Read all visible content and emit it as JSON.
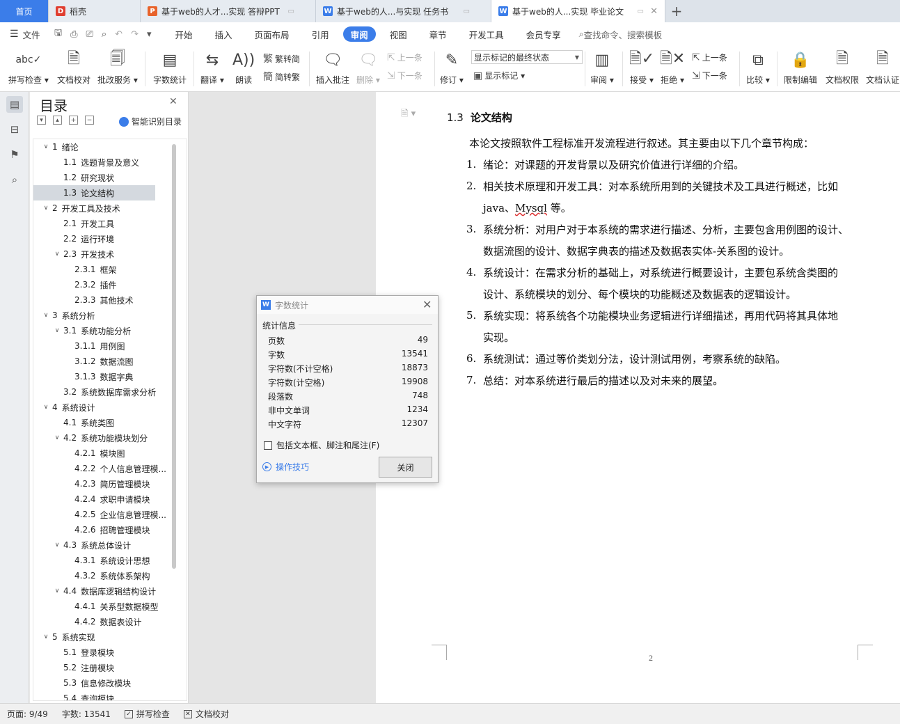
{
  "tabs": [
    {
      "label": "首页",
      "icon": "home",
      "active": false
    },
    {
      "label": "稻壳",
      "icon": "daoke-icon",
      "active": false
    },
    {
      "label": "基于web的人才...实现 答辩PPT",
      "icon": "ppt-icon",
      "active": false
    },
    {
      "label": "基于web的人...与实现 任务书",
      "icon": "wps-writer-icon",
      "active": false
    },
    {
      "label": "基于web的人...实现 毕业论文",
      "icon": "wps-writer-icon",
      "active": true
    }
  ],
  "menubar": {
    "file_label": "文件",
    "items": [
      "开始",
      "插入",
      "页面布局",
      "引用",
      "审阅",
      "视图",
      "章节",
      "开发工具",
      "会员专享"
    ],
    "active": "审阅",
    "search_label": "查找命令、搜索模板"
  },
  "ribbon": {
    "spell_check": "拼写检查",
    "doc_proof": "文档校对",
    "revise_service": "批改服务",
    "word_count": "字数统计",
    "translate": "翻译",
    "read_aloud": "朗读",
    "trad_conv": "繁转简",
    "simp_conv": "简转繁",
    "insert_comment": "插入批注",
    "delete": "删除",
    "prev_comment": "上一条",
    "next_comment": "下一条",
    "revise": "修订",
    "markup_state": "显示标记的最终状态",
    "show_markup": "显示标记",
    "review": "审阅",
    "accept": "接受",
    "reject": "拒绝",
    "prev_change": "上一条",
    "next_change": "下一条",
    "compare": "比较",
    "restrict_edit": "限制编辑",
    "doc_permission": "文档权限",
    "doc_auth": "文档认证"
  },
  "toc": {
    "title": "目录",
    "smart_label": "智能识别目录",
    "items": [
      {
        "num": "1",
        "text": "绪论",
        "level": 1,
        "toggle": "expanded"
      },
      {
        "num": "1.1",
        "text": "选题背景及意义",
        "level": 2,
        "toggle": "none"
      },
      {
        "num": "1.2",
        "text": "研究现状",
        "level": 2,
        "toggle": "none"
      },
      {
        "num": "1.3",
        "text": "论文结构",
        "level": 2,
        "toggle": "none",
        "selected": true
      },
      {
        "num": "2",
        "text": "开发工具及技术",
        "level": 1,
        "toggle": "expanded"
      },
      {
        "num": "2.1",
        "text": "开发工具",
        "level": 2,
        "toggle": "none"
      },
      {
        "num": "2.2",
        "text": "运行环境",
        "level": 2,
        "toggle": "none"
      },
      {
        "num": "2.3",
        "text": "开发技术",
        "level": 2,
        "toggle": "expanded"
      },
      {
        "num": "2.3.1",
        "text": "框架",
        "level": 3,
        "toggle": "none"
      },
      {
        "num": "2.3.2",
        "text": "插件",
        "level": 3,
        "toggle": "none"
      },
      {
        "num": "2.3.3",
        "text": "其他技术",
        "level": 3,
        "toggle": "none"
      },
      {
        "num": "3",
        "text": "系统分析",
        "level": 1,
        "toggle": "expanded"
      },
      {
        "num": "3.1",
        "text": "系统功能分析",
        "level": 2,
        "toggle": "expanded"
      },
      {
        "num": "3.1.1",
        "text": "用例图",
        "level": 3,
        "toggle": "none"
      },
      {
        "num": "3.1.2",
        "text": "数据流图",
        "level": 3,
        "toggle": "none"
      },
      {
        "num": "3.1.3",
        "text": "数据字典",
        "level": 3,
        "toggle": "none"
      },
      {
        "num": "3.2",
        "text": "系统数据库需求分析",
        "level": 2,
        "toggle": "none"
      },
      {
        "num": "4",
        "text": "系统设计",
        "level": 1,
        "toggle": "expanded"
      },
      {
        "num": "4.1",
        "text": "系统类图",
        "level": 2,
        "toggle": "none"
      },
      {
        "num": "4.2",
        "text": "系统功能模块划分",
        "level": 2,
        "toggle": "expanded"
      },
      {
        "num": "4.2.1",
        "text": "模块图",
        "level": 3,
        "toggle": "none"
      },
      {
        "num": "4.2.2",
        "text": "个人信息管理模...",
        "level": 3,
        "toggle": "none"
      },
      {
        "num": "4.2.3",
        "text": "简历管理模块",
        "level": 3,
        "toggle": "none"
      },
      {
        "num": "4.2.4",
        "text": "求职申请模块",
        "level": 3,
        "toggle": "none"
      },
      {
        "num": "4.2.5",
        "text": "企业信息管理模...",
        "level": 3,
        "toggle": "none"
      },
      {
        "num": "4.2.6",
        "text": "招聘管理模块",
        "level": 3,
        "toggle": "none"
      },
      {
        "num": "4.3",
        "text": "系统总体设计",
        "level": 2,
        "toggle": "expanded"
      },
      {
        "num": "4.3.1",
        "text": "系统设计思想",
        "level": 3,
        "toggle": "none"
      },
      {
        "num": "4.3.2",
        "text": "系统体系架构",
        "level": 3,
        "toggle": "none"
      },
      {
        "num": "4.4",
        "text": "数据库逻辑结构设计",
        "level": 2,
        "toggle": "expanded"
      },
      {
        "num": "4.4.1",
        "text": "关系型数据模型",
        "level": 3,
        "toggle": "none"
      },
      {
        "num": "4.4.2",
        "text": "数据表设计",
        "level": 3,
        "toggle": "none"
      },
      {
        "num": "5",
        "text": "系统实现",
        "level": 1,
        "toggle": "expanded"
      },
      {
        "num": "5.1",
        "text": "登录模块",
        "level": 2,
        "toggle": "none"
      },
      {
        "num": "5.2",
        "text": "注册模块",
        "level": 2,
        "toggle": "none"
      },
      {
        "num": "5.3",
        "text": "信息修改模块",
        "level": 2,
        "toggle": "none"
      },
      {
        "num": "5.4",
        "text": "查询模块",
        "level": 2,
        "toggle": "none"
      }
    ]
  },
  "document": {
    "section_num": "1.3",
    "section_title": "论文结构",
    "intro": "本论文按照软件工程标准开发流程进行叙述。其主要由以下几个章节构成：",
    "list": [
      {
        "num": "1.",
        "lines": [
          "绪论：对课题的开发背景以及研究价值进行详细的介绍。"
        ]
      },
      {
        "num": "2.",
        "lines": [
          "相关技术原理和开发工具：对本系统所用到的关键技术及工具进行概述，比如",
          "java、Mysql 等。"
        ]
      },
      {
        "num": "3.",
        "lines": [
          "系统分析：对用户对于本系统的需求进行描述、分析，主要包含用例图的设计、",
          "数据流图的设计、数据字典表的描述及数据表实体-关系图的设计。"
        ]
      },
      {
        "num": "4.",
        "lines": [
          "系统设计：在需求分析的基础上，对系统进行概要设计，主要包系统含类图的",
          "设计、系统模块的划分、每个模块的功能概述及数据表的逻辑设计。"
        ]
      },
      {
        "num": "5.",
        "lines": [
          "系统实现：将系统各个功能模块业务逻辑进行详细描述，再用代码将其具体地",
          "实现。"
        ]
      },
      {
        "num": "6.",
        "lines": [
          "系统测试：通过等价类划分法，设计测试用例，考察系统的缺陷。"
        ]
      },
      {
        "num": "7.",
        "lines": [
          "总结：对本系统进行最后的描述以及对未来的展望。"
        ]
      }
    ],
    "page_number": "2"
  },
  "dialog": {
    "title": "字数统计",
    "group_label": "统计信息",
    "stats": [
      {
        "label": "页数",
        "value": "49"
      },
      {
        "label": "字数",
        "value": "13541"
      },
      {
        "label": "字符数(不计空格)",
        "value": "18873"
      },
      {
        "label": "字符数(计空格)",
        "value": "19908"
      },
      {
        "label": "段落数",
        "value": "748"
      },
      {
        "label": "非中文单词",
        "value": "1234"
      },
      {
        "label": "中文字符",
        "value": "12307"
      }
    ],
    "include_label": "包括文本框、脚注和尾注(F)",
    "tips_label": "操作技巧",
    "close_label": "关闭"
  },
  "statusbar": {
    "page": "页面: 9/49",
    "words": "字数: 13541",
    "spell": "拼写检查",
    "proof": "文档校对"
  },
  "colors": {
    "accent": "#3b7de9",
    "tab_bar": "#dde3ea",
    "canvas": "#e5e5e5"
  }
}
